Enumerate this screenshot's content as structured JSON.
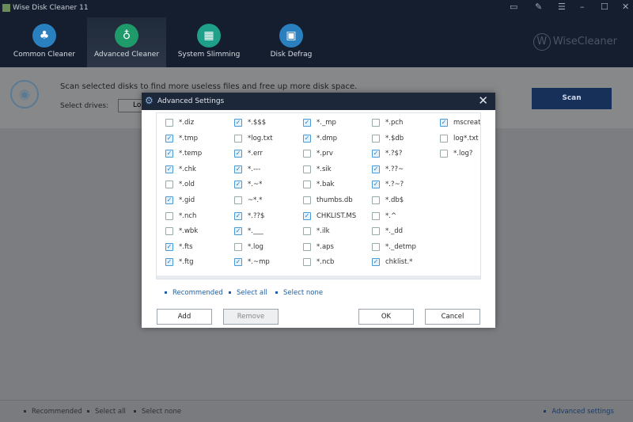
{
  "app": {
    "title": "Wise Disk Cleaner 11",
    "brand": "WiseCleaner"
  },
  "window_controls": [
    "feedback-icon",
    "notes-icon",
    "menu-icon",
    "minimize-icon",
    "maximize-icon",
    "close-icon"
  ],
  "nav": [
    {
      "label": "Common Cleaner",
      "icon": "broom-icon",
      "color": "#2a7fbf",
      "active": false
    },
    {
      "label": "Advanced Cleaner",
      "icon": "vacuum-icon",
      "color": "#1f9a6a",
      "active": true
    },
    {
      "label": "System Slimming",
      "icon": "windows-icon",
      "color": "#1fa08a",
      "active": false
    },
    {
      "label": "Disk Defrag",
      "icon": "disk-icon",
      "color": "#2a7fbf",
      "active": false
    }
  ],
  "main": {
    "description": "Scan selected disks to find more useless files and free up more disk space.",
    "select_drives_label": "Select drives:",
    "drive_value": "Lo",
    "scan_label": "Scan"
  },
  "bottom": {
    "recommended": "Recommended",
    "select_all": "Select all",
    "select_none": "Select none",
    "advanced_settings": "Advanced settings"
  },
  "dialog": {
    "title": "Advanced Settings",
    "columns": [
      [
        {
          "label": "*.diz",
          "checked": false
        },
        {
          "label": "*.tmp",
          "checked": true
        },
        {
          "label": "*.temp",
          "checked": true
        },
        {
          "label": "*.chk",
          "checked": true
        },
        {
          "label": "*.old",
          "checked": false
        },
        {
          "label": "*.gid",
          "checked": true
        },
        {
          "label": "*.nch",
          "checked": false
        },
        {
          "label": "*.wbk",
          "checked": false
        },
        {
          "label": "*.fts",
          "checked": true
        },
        {
          "label": "*.ftg",
          "checked": true
        }
      ],
      [
        {
          "label": "*.$$$",
          "checked": true
        },
        {
          "label": "*log.txt",
          "checked": false
        },
        {
          "label": "*.err",
          "checked": true
        },
        {
          "label": "*.---",
          "checked": true
        },
        {
          "label": "*.~*",
          "checked": true
        },
        {
          "label": "~*.*",
          "checked": false
        },
        {
          "label": "*.??$",
          "checked": true
        },
        {
          "label": "*.___",
          "checked": true
        },
        {
          "label": "*.log",
          "checked": false
        },
        {
          "label": "*.~mp",
          "checked": true
        }
      ],
      [
        {
          "label": "*._mp",
          "checked": true
        },
        {
          "label": "*.dmp",
          "checked": true
        },
        {
          "label": "*.prv",
          "checked": false
        },
        {
          "label": "*.sik",
          "checked": false
        },
        {
          "label": "*.bak",
          "checked": false
        },
        {
          "label": "thumbs.db",
          "checked": false
        },
        {
          "label": "CHKLIST.MS",
          "checked": true
        },
        {
          "label": "*.ilk",
          "checked": false
        },
        {
          "label": "*.aps",
          "checked": false
        },
        {
          "label": "*.ncb",
          "checked": false
        }
      ],
      [
        {
          "label": "*.pch",
          "checked": false
        },
        {
          "label": "*.$db",
          "checked": false
        },
        {
          "label": "*.?$?",
          "checked": true
        },
        {
          "label": "*.??~",
          "checked": true
        },
        {
          "label": "*.?~?",
          "checked": true
        },
        {
          "label": "*.db$",
          "checked": false
        },
        {
          "label": "*.^",
          "checked": false
        },
        {
          "label": "*._dd",
          "checked": false
        },
        {
          "label": "*._detmp",
          "checked": false
        },
        {
          "label": "chklist.*",
          "checked": true
        }
      ],
      [
        {
          "label": "mscreate.",
          "checked": true
        },
        {
          "label": "log*.txt",
          "checked": false
        },
        {
          "label": "*.log?",
          "checked": false
        }
      ]
    ],
    "recommended": "Recommended",
    "select_all": "Select all",
    "select_none": "Select none",
    "add": "Add",
    "remove": "Remove",
    "ok": "OK",
    "cancel": "Cancel"
  }
}
